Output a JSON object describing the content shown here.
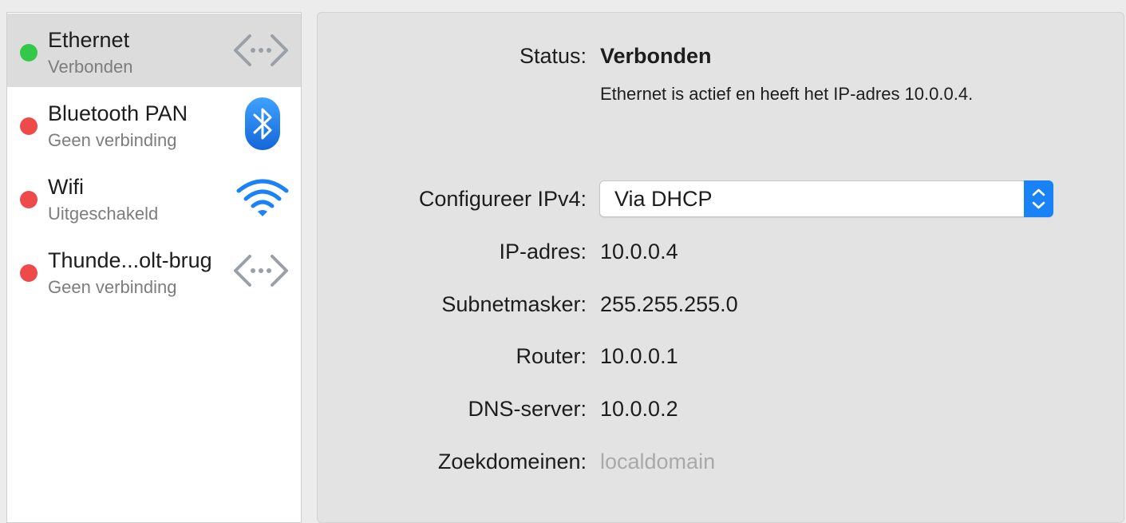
{
  "sidebar": {
    "services": [
      {
        "name": "Ethernet",
        "status": "Verbonden",
        "status_color": "#34c84a",
        "icon": "ethernet-icon",
        "selected": true
      },
      {
        "name": "Bluetooth PAN",
        "status": "Geen verbinding",
        "status_color": "#ee4a4a",
        "icon": "bluetooth-icon",
        "selected": false
      },
      {
        "name": "Wifi",
        "status": "Uitgeschakeld",
        "status_color": "#ee4a4a",
        "icon": "wifi-icon",
        "selected": false
      },
      {
        "name": "Thunde...olt-brug",
        "status": "Geen verbinding",
        "status_color": "#ee4a4a",
        "icon": "thunderbolt-bridge-icon",
        "selected": false
      }
    ]
  },
  "detail": {
    "status_label": "Status:",
    "status_value": "Verbonden",
    "status_description": "Ethernet is actief en heeft het IP-adres 10.0.0.4.",
    "configure_label": "Configureer IPv4:",
    "configure_value": "Via DHCP",
    "ip_label": "IP-adres:",
    "ip_value": "10.0.0.4",
    "subnet_label": "Subnetmasker:",
    "subnet_value": "255.255.255.0",
    "router_label": "Router:",
    "router_value": "10.0.0.1",
    "dns_label": "DNS-server:",
    "dns_value": "10.0.0.2",
    "search_label": "Zoekdomeinen:",
    "search_placeholder": "localdomain"
  },
  "colors": {
    "accent": "#1a82f7",
    "connected": "#34c84a",
    "disconnected": "#ee4a4a"
  }
}
